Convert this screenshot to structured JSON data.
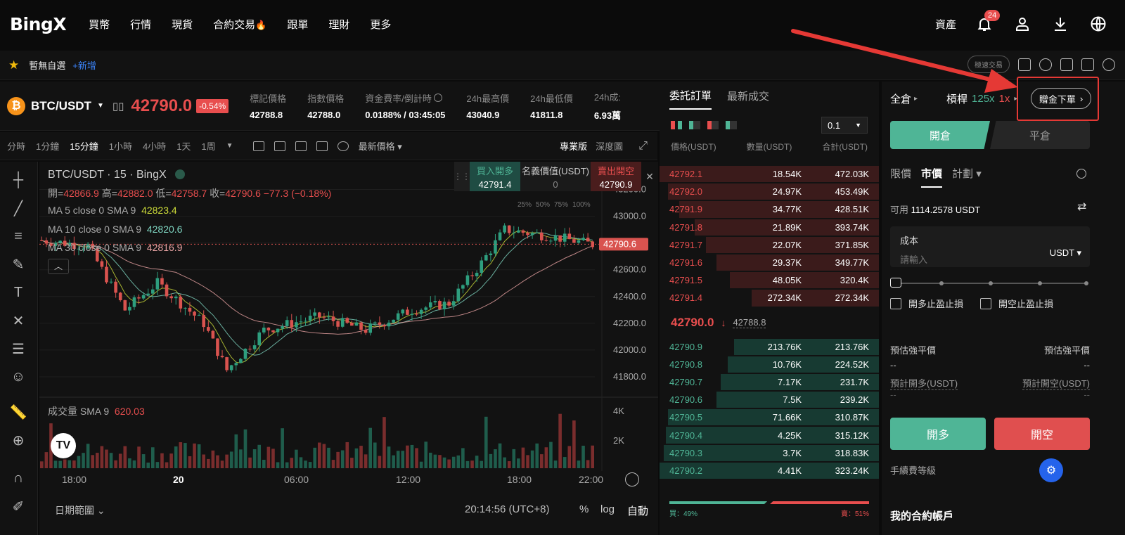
{
  "nav": {
    "logo": "BingX",
    "items": [
      "買幣",
      "行情",
      "現貨",
      "合約交易",
      "跟單",
      "理財",
      "更多"
    ],
    "assets": "資產",
    "notif_count": "24"
  },
  "favbar": {
    "label": "暫無自選",
    "add": "+新增",
    "grid_pill": "極速交易"
  },
  "ticker": {
    "pair": "BTC/USDT",
    "price": "42790.0",
    "change": "-0.54%",
    "stats": [
      {
        "k": "標記價格",
        "v": "42788.8"
      },
      {
        "k": "指數價格",
        "v": "42788.0"
      },
      {
        "k": "資金費率/倒計時",
        "v": "0.0188% / 03:45:05"
      },
      {
        "k": "24h最高價",
        "v": "43040.9"
      },
      {
        "k": "24h最低價",
        "v": "41811.8"
      },
      {
        "k": "24h成:",
        "v": "6.93萬"
      }
    ]
  },
  "chart_toolbar": {
    "intervals": [
      "分時",
      "1分鐘",
      "15分鐘",
      "1小時",
      "4小時",
      "1天",
      "1周"
    ],
    "active": "15分鐘",
    "price_type": "最新價格",
    "pro": "專業版",
    "depth": "深度圖"
  },
  "chart": {
    "title": "BTC/USDT · 15 · BingX",
    "ohlc": {
      "o_label": "開=",
      "o": "42866.9",
      "h_label": "高=",
      "h": "42882.0",
      "l_label": "低=",
      "l": "42758.7",
      "c_label": "收=",
      "c": "42790.6",
      "chg": "−77.3 (−0.18%)"
    },
    "ma": [
      {
        "label": "MA 5 close 0 SMA 9",
        "value": "42823.4",
        "color": "#cddc39"
      },
      {
        "label": "MA 10 close 0 SMA 9",
        "value": "42820.6",
        "color": "#7fd6c2"
      },
      {
        "label": "MA 30 close 0 SMA 9",
        "value": "42816.9",
        "color": "#e8a3a3"
      }
    ],
    "yticks": [
      "43200.0",
      "43000.0",
      "42800.0",
      "42600.0",
      "42400.0",
      "42200.0",
      "42000.0",
      "41800.0"
    ],
    "last_price": "42790.6",
    "volume_label": "成交量 SMA 9",
    "volume_value": "620.03",
    "vol_ticks": [
      "4K",
      "2K"
    ],
    "xticks": [
      "18:00",
      "20",
      "06:00",
      "12:00",
      "18:00",
      "22:00"
    ],
    "quick_buy": "買入開多",
    "quick_buy_price": "42791.4",
    "quick_mid_label": "名義價值(USDT)",
    "quick_mid_value": "0",
    "quick_sell": "賣出開空",
    "quick_sell_price": "42790.9",
    "pcts": [
      "25%",
      "50%",
      "75%",
      "100%"
    ],
    "date_range": "日期範圍",
    "time": "20:14:56 (UTC+8)",
    "pct": "%",
    "log": "log",
    "auto": "自動"
  },
  "orderbook": {
    "tabs": [
      "委託訂單",
      "最新成交"
    ],
    "step": "0.1",
    "headers": [
      "價格(USDT)",
      "數量(USDT)",
      "合計(USDT)"
    ],
    "asks": [
      {
        "p": "42792.1",
        "q": "18.54K",
        "t": "472.03K",
        "w": 1.0
      },
      {
        "p": "42792.0",
        "q": "24.97K",
        "t": "453.49K",
        "w": 0.96
      },
      {
        "p": "42791.9",
        "q": "34.77K",
        "t": "428.51K",
        "w": 0.91
      },
      {
        "p": "42791.8",
        "q": "21.89K",
        "t": "393.74K",
        "w": 0.84
      },
      {
        "p": "42791.7",
        "q": "22.07K",
        "t": "371.85K",
        "w": 0.79
      },
      {
        "p": "42791.6",
        "q": "29.37K",
        "t": "349.77K",
        "w": 0.74
      },
      {
        "p": "42791.5",
        "q": "48.05K",
        "t": "320.4K",
        "w": 0.68
      },
      {
        "p": "42791.4",
        "q": "272.34K",
        "t": "272.34K",
        "w": 0.58
      }
    ],
    "last": "42790.0",
    "mark": "42788.8",
    "bids": [
      {
        "p": "42790.9",
        "q": "213.76K",
        "t": "213.76K",
        "w": 0.66
      },
      {
        "p": "42790.8",
        "q": "10.76K",
        "t": "224.52K",
        "w": 0.69
      },
      {
        "p": "42790.7",
        "q": "7.17K",
        "t": "231.7K",
        "w": 0.72
      },
      {
        "p": "42790.6",
        "q": "7.5K",
        "t": "239.2K",
        "w": 0.74
      },
      {
        "p": "42790.5",
        "q": "71.66K",
        "t": "310.87K",
        "w": 0.96
      },
      {
        "p": "42790.4",
        "q": "4.25K",
        "t": "315.12K",
        "w": 0.97
      },
      {
        "p": "42790.3",
        "q": "3.7K",
        "t": "318.83K",
        "w": 0.98
      },
      {
        "p": "42790.2",
        "q": "4.41K",
        "t": "323.24K",
        "w": 1.0
      }
    ],
    "buy_ratio": "買：49%",
    "sell_ratio": "賣：51%"
  },
  "panel": {
    "margin": "全倉",
    "leverage_label": "槓桿",
    "leverage": "125x",
    "leverage2": "1x",
    "bonus": "贈金下單",
    "open": "開倉",
    "close": "平倉",
    "types": [
      "限價",
      "市價",
      "計劃"
    ],
    "available_label": "可用",
    "available": "1114.2578 USDT",
    "cost_label": "成本",
    "cost_placeholder": "請輸入",
    "unit": "USDT",
    "tp_long": "開多止盈止損",
    "tp_short": "開空止盈止損",
    "liq_left": "預估強平價",
    "liq_right": "預估強平價",
    "dash": "--",
    "est_long": "預計開多(USDT)",
    "est_short": "預計開空(USDT)",
    "long_btn": "開多",
    "short_btn": "開空",
    "fee": "手續費等級",
    "account": "我的合約帳戶"
  }
}
